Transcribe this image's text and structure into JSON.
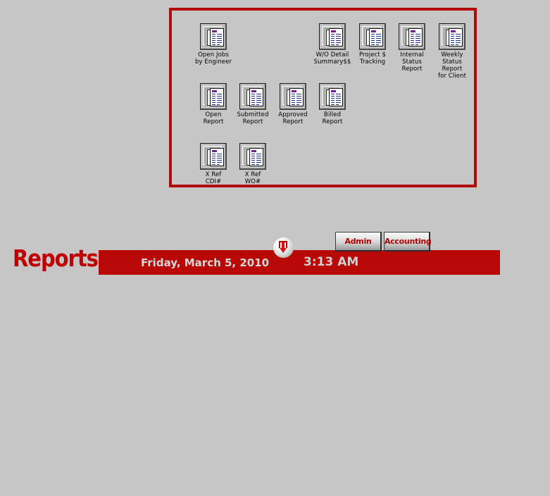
{
  "window": {
    "background_color": "#c6c6c6",
    "accent_color": "#b00a0a",
    "banner_color": "#b80808"
  },
  "panel": {
    "name": "reports-shortcut-panel",
    "border_color": "#b00a0a",
    "reports": [
      {
        "label": "Open Jobs\nby Engineer",
        "icon": "report-document-icon",
        "row": 1,
        "col": 0
      },
      {
        "label": "W/O Detail\nSummary$$",
        "icon": "report-document-icon",
        "row": 1,
        "col": 3
      },
      {
        "label": "Project $\nTracking",
        "icon": "report-document-icon",
        "row": 1,
        "col": 4
      },
      {
        "label": "Internal Status\nReport",
        "icon": "report-document-icon",
        "row": 1,
        "col": 5
      },
      {
        "label": "Weekly\nStatus Report\nfor Client",
        "icon": "report-document-icon",
        "row": 1,
        "col": 6
      },
      {
        "label": "Open\nReport",
        "icon": "report-document-icon",
        "row": 2,
        "col": 0
      },
      {
        "label": "Submitted\nReport",
        "icon": "report-document-icon",
        "row": 2,
        "col": 1
      },
      {
        "label": "Approved\nReport",
        "icon": "report-document-icon",
        "row": 2,
        "col": 2
      },
      {
        "label": "Billed\nReport",
        "icon": "report-document-icon",
        "row": 2,
        "col": 3
      },
      {
        "label": "X Ref\nCDI#",
        "icon": "report-document-icon",
        "row": 3,
        "col": 0
      },
      {
        "label": "X Ref\nWO#",
        "icon": "report-document-icon",
        "row": 3,
        "col": 1
      }
    ]
  },
  "banner": {
    "title": "Reports",
    "date": "Friday, March 5, 2010",
    "time": "3:13 AM"
  },
  "toolbar": {
    "export_icon": "download-arrow-sphere-icon",
    "buttons": [
      {
        "label": "Admin",
        "name": "admin-button"
      },
      {
        "label": "Accounting",
        "name": "accounting-button"
      }
    ]
  }
}
